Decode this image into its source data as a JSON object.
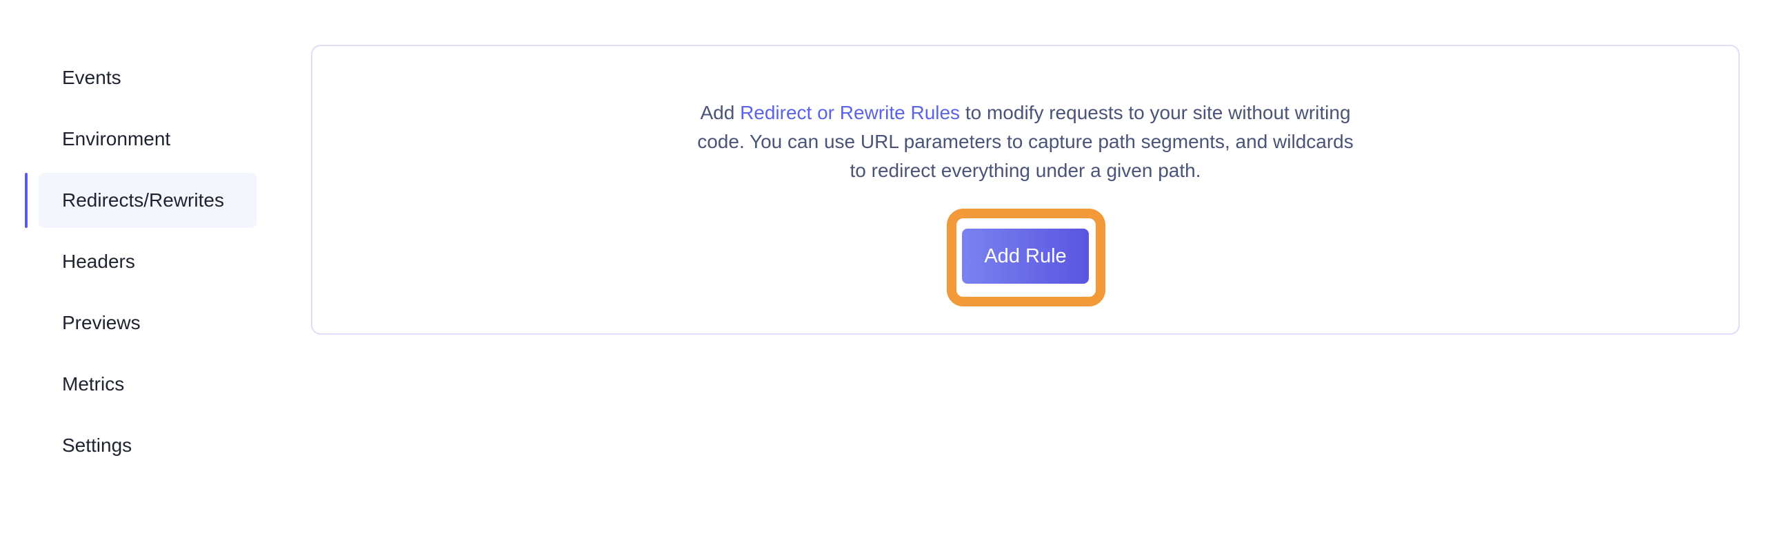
{
  "sidebar": {
    "items": [
      {
        "label": "Events",
        "active": false
      },
      {
        "label": "Environment",
        "active": false
      },
      {
        "label": "Redirects/Rewrites",
        "active": true
      },
      {
        "label": "Headers",
        "active": false
      },
      {
        "label": "Previews",
        "active": false
      },
      {
        "label": "Metrics",
        "active": false
      },
      {
        "label": "Settings",
        "active": false
      }
    ]
  },
  "main": {
    "description_prefix": "Add ",
    "description_link": "Redirect or Rewrite Rules",
    "description_suffix": " to modify requests to your site without writing code. You can use URL parameters to capture path segments, and wildcards to redirect everything under a given path.",
    "add_rule_label": "Add Rule"
  },
  "colors": {
    "accent": "#5b63e6",
    "highlight": "#f29a3a",
    "active_bg": "#f3f6fd"
  }
}
